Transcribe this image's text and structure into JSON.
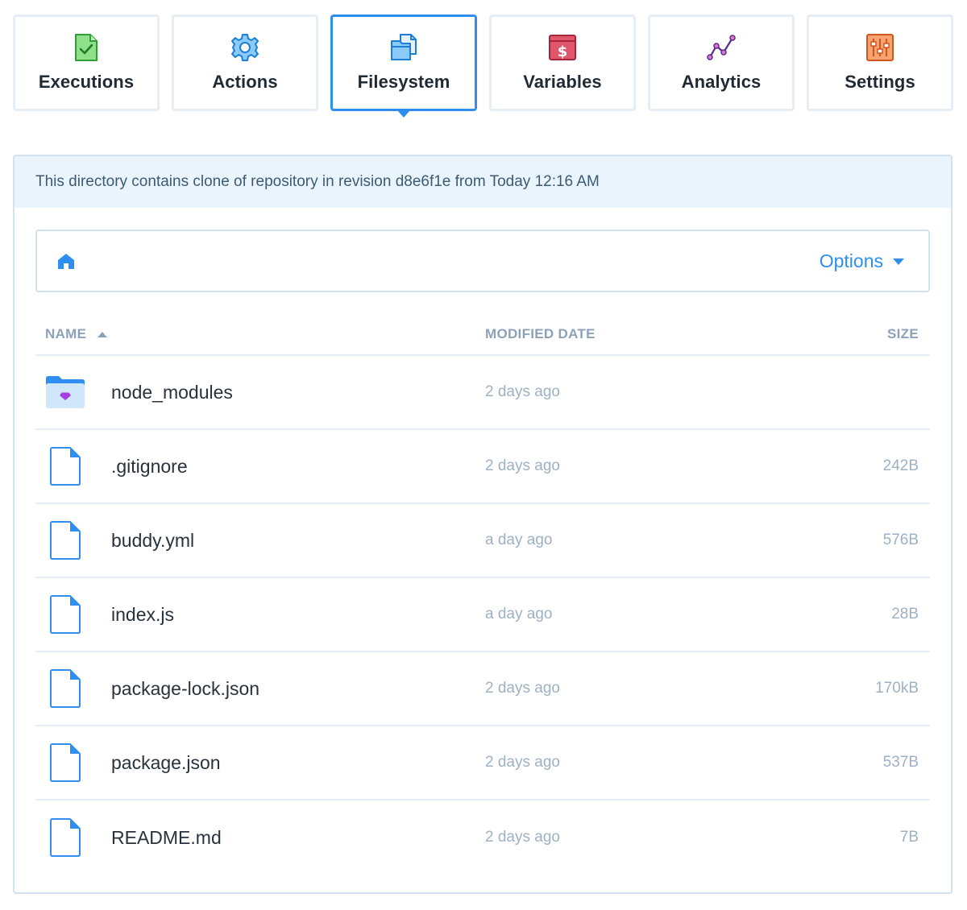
{
  "tabs": [
    {
      "label": "Executions",
      "icon": "executions-icon",
      "active": false
    },
    {
      "label": "Actions",
      "icon": "gear-icon",
      "active": false
    },
    {
      "label": "Filesystem",
      "icon": "filesystem-icon",
      "active": true
    },
    {
      "label": "Variables",
      "icon": "variables-icon",
      "active": false
    },
    {
      "label": "Analytics",
      "icon": "analytics-icon",
      "active": false
    },
    {
      "label": "Settings",
      "icon": "settings-sliders-icon",
      "active": false
    }
  ],
  "info": {
    "text": "This directory contains clone of repository in revision d8e6f1e from Today 12:16 AM"
  },
  "toolbar": {
    "home_icon": "home-icon",
    "options_label": "Options"
  },
  "table": {
    "headers": {
      "name": "NAME",
      "date": "MODIFIED DATE",
      "size": "SIZE"
    },
    "sort": {
      "column": "name",
      "direction": "asc"
    },
    "rows": [
      {
        "name": "node_modules",
        "type": "folder",
        "modified": "2 days ago",
        "size": ""
      },
      {
        "name": ".gitignore",
        "type": "file",
        "modified": "2 days ago",
        "size": "242B"
      },
      {
        "name": "buddy.yml",
        "type": "file",
        "modified": "a day ago",
        "size": "576B"
      },
      {
        "name": "index.js",
        "type": "file",
        "modified": "a day ago",
        "size": "28B"
      },
      {
        "name": "package-lock.json",
        "type": "file",
        "modified": "2 days ago",
        "size": "170kB"
      },
      {
        "name": "package.json",
        "type": "file",
        "modified": "2 days ago",
        "size": "537B"
      },
      {
        "name": "README.md",
        "type": "file",
        "modified": "2 days ago",
        "size": "7B"
      }
    ]
  },
  "colors": {
    "accent": "#2f8ff0",
    "border": "#d3e2f1",
    "info_bg": "#eaf4fc",
    "muted_text": "#9eb1c3"
  }
}
